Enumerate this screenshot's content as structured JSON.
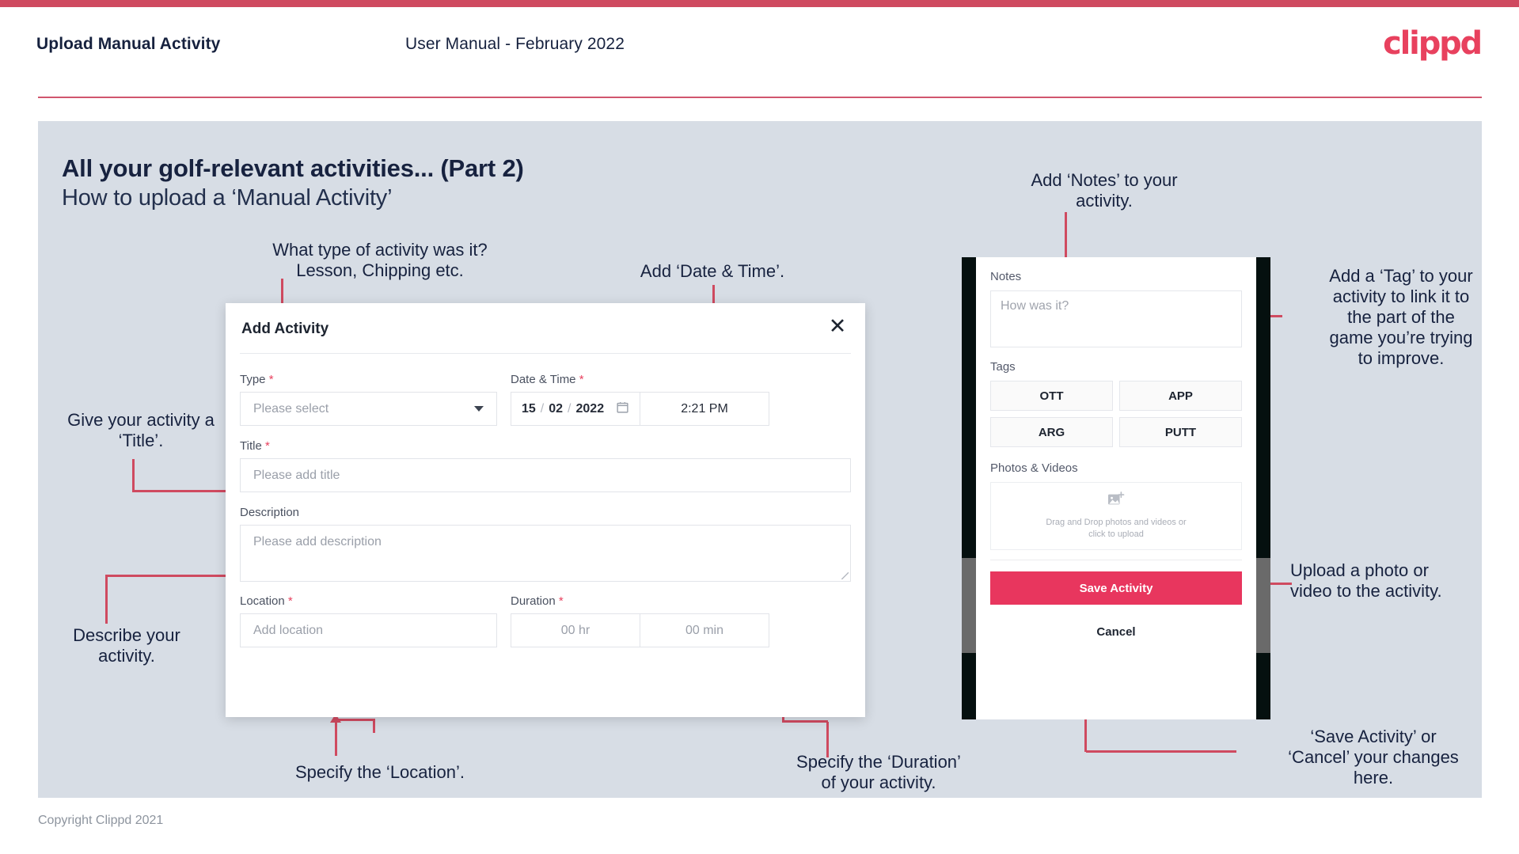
{
  "header": {
    "title": "Upload Manual Activity",
    "subtitle": "User Manual - February 2022",
    "logo": "clippd"
  },
  "slide": {
    "title": "All your golf-relevant activities... (Part 2)",
    "subtitle": "How to upload a ‘Manual Activity’"
  },
  "footer": {
    "copyright": "Copyright Clippd 2021"
  },
  "colors": {
    "accent": "#cf4a60",
    "brand_pink": "#e8415e",
    "slide_bg": "#d7dde5",
    "text_navy": "#17223f",
    "save_button": "#e8365e"
  },
  "dialog": {
    "title": "Add Activity",
    "close_icon": "close-icon",
    "type": {
      "label": "Type",
      "required": "*",
      "placeholder": "Please select",
      "chevron_icon": "chevron-down-icon"
    },
    "datetime": {
      "label": "Date & Time",
      "required": "*",
      "day": "15",
      "sep1": "/",
      "month": "02",
      "sep2": "/",
      "year": "2022",
      "calendar_icon": "calendar-icon",
      "time": "2:21 PM"
    },
    "title_field": {
      "label": "Title",
      "required": "*",
      "placeholder": "Please add title"
    },
    "description": {
      "label": "Description",
      "placeholder": "Please add description"
    },
    "location": {
      "label": "Location",
      "required": "*",
      "placeholder": "Add location"
    },
    "duration": {
      "label": "Duration",
      "required": "*",
      "hours_placeholder": "00 hr",
      "minutes_placeholder": "00 min"
    }
  },
  "phone": {
    "notes": {
      "label": "Notes",
      "placeholder": "How was it?"
    },
    "tags": {
      "label": "Tags",
      "items": [
        "OTT",
        "APP",
        "ARG",
        "PUTT"
      ]
    },
    "photos": {
      "label": "Photos & Videos",
      "icon": "add-image-icon",
      "line1": "Drag and Drop photos and videos or",
      "line2": "click to upload"
    },
    "save_label": "Save Activity",
    "cancel_label": "Cancel"
  },
  "annotations": {
    "type": "What type of activity was it?\nLesson, Chipping etc.",
    "datetime": "Add ‘Date & Time’.",
    "title": "Give your activity a\n‘Title’.",
    "description": "Describe your\nactivity.",
    "location": "Specify the ‘Location’.",
    "duration": "Specify the ‘Duration’\nof your activity.",
    "notes": "Add ‘Notes’ to your\nactivity.",
    "tags": "Add a ‘Tag’ to your\nactivity to link it to\nthe part of the\ngame you’re trying\nto improve.",
    "upload": "Upload a photo or\nvideo to the activity.",
    "save": "‘Save Activity’ or\n‘Cancel’ your changes\nhere."
  }
}
